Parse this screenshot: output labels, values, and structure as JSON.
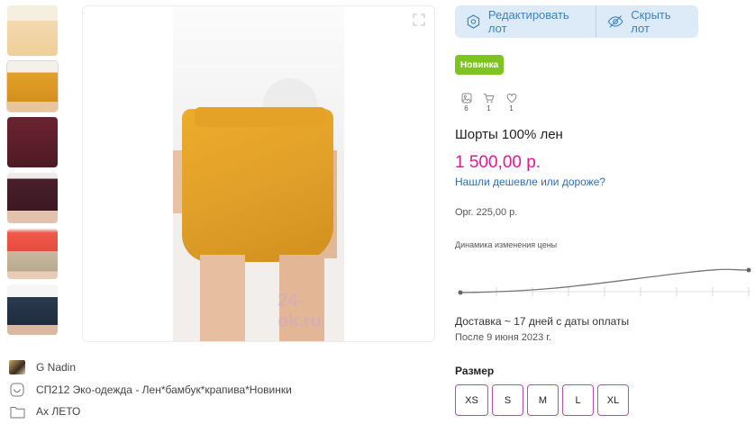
{
  "thumbnails": [
    {
      "color": "#efcf9a"
    },
    {
      "color": "#e3a128"
    },
    {
      "color": "#4e1a24"
    },
    {
      "color": "#3c1822"
    },
    {
      "color": "#e84c3d"
    },
    {
      "color": "#1f2c3e"
    }
  ],
  "main_image": {
    "watermark": "24-ok.ru"
  },
  "actions": {
    "edit_label": "Редактировать лот",
    "hide_label": "Скрыть лот",
    "accent_bg": "#dcebf7",
    "accent_text": "#3a83c9"
  },
  "badge": {
    "label": "Новинка",
    "color": "#7dc41f"
  },
  "stats": [
    {
      "icon": "photo-icon",
      "count": "6"
    },
    {
      "icon": "cart-icon",
      "count": "1"
    },
    {
      "icon": "heart-icon",
      "count": "1"
    }
  ],
  "product": {
    "title": "Шорты 100% лен",
    "price": "1 500,00 р.",
    "price_color": "#e5178d",
    "cheaper_link": "Нашли дешевле или дороже?",
    "org_fee": "Орг.  225,00 р."
  },
  "price_dynamics": {
    "label": "Динамика изменения цены"
  },
  "delivery": {
    "text": "Доставка ~ 17 дней с даты оплаты",
    "after": "После 9 июня 2023 г."
  },
  "sizes": {
    "label": "Размер",
    "options": [
      "XS",
      "S",
      "M",
      "L",
      "XL"
    ],
    "border_color": "#b44fb9"
  },
  "meta": {
    "seller": "G Nadin",
    "purchase": "СП212 Эко-одежда - Лен*бамбук*крапива*Новинки",
    "category": "Ах ЛЕТО"
  }
}
